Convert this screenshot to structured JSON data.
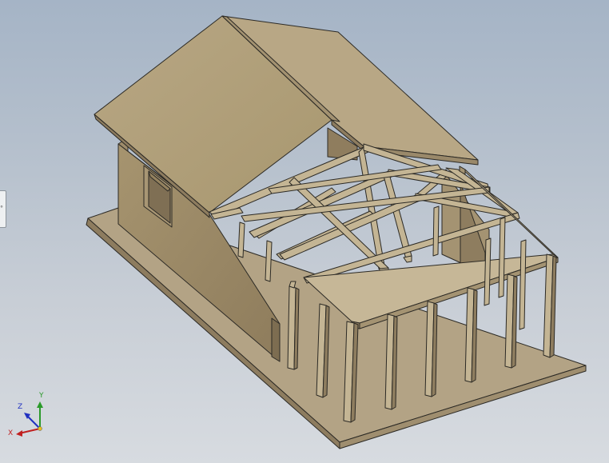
{
  "viewport": {
    "model": "house-frame-assembly"
  },
  "side_panel_tab": {
    "glyph": "°",
    "icon": "panel-expand-icon"
  },
  "triad": {
    "x_label": "X",
    "y_label": "Y",
    "z_label": "Z",
    "colors": {
      "x": "#c02020",
      "y": "#2a9a2a",
      "z": "#2030c0"
    }
  },
  "colors": {
    "wood_top": "#b0a081",
    "wood_light": "#c3b493",
    "wood_side": "#9d8c6c",
    "wood_dark": "#7d6d51",
    "edge": "#2c2a25",
    "background_top": "#a5b4c6",
    "background_bottom": "#d7dbe0"
  }
}
